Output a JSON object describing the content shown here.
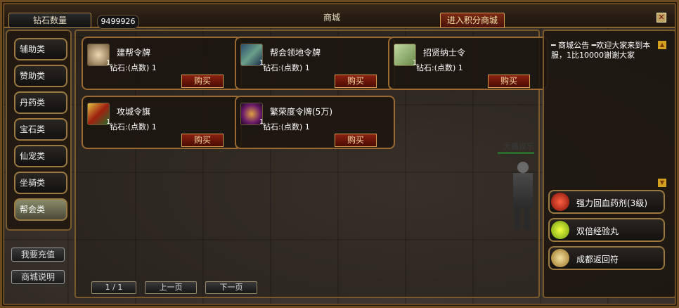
{
  "header": {
    "diamond_label": "钻石数量",
    "diamond_count": "9499926",
    "title": "商城",
    "points_shop_button": "进入积分商城",
    "close_icon": "close-icon"
  },
  "categories": [
    {
      "label": "辅助类"
    },
    {
      "label": "赞助类"
    },
    {
      "label": "丹药类"
    },
    {
      "label": "宝石类"
    },
    {
      "label": "仙宠类"
    },
    {
      "label": "坐骑类"
    },
    {
      "label": "帮会类"
    }
  ],
  "side_buttons": {
    "recharge": "我要充值",
    "help": "商城说明"
  },
  "items": [
    {
      "name": "建帮令牌",
      "qty": "1",
      "price": "钻石:(点数) 1",
      "buy": "购买",
      "icon": "token-icon",
      "color": "#b89a70"
    },
    {
      "name": "帮会领地令牌",
      "qty": "1",
      "price": "钻石:(点数) 1",
      "buy": "购买",
      "icon": "territory-token-icon",
      "color": "#3a6a5a"
    },
    {
      "name": "招贤纳士令",
      "qty": "1",
      "price": "钻石:(点数) 1",
      "buy": "购买",
      "icon": "scroll-icon",
      "color": "#8aa06a"
    },
    {
      "name": "攻城令旗",
      "qty": "1",
      "price": "钻石:(点数) 1",
      "buy": "购买",
      "icon": "flag-icon",
      "color": "#a04020"
    },
    {
      "name": "繁荣度令牌(5万)",
      "qty": "1",
      "price": "钻石:(点数) 1",
      "buy": "购买",
      "icon": "prosperity-token-icon",
      "color": "#6a1a6a"
    }
  ],
  "pagination": {
    "page": "1 / 1",
    "prev": "上一页",
    "next": "下一页"
  },
  "notice": {
    "text": "━ 商城公告 ━欢迎大家来到本服，1比10000谢谢大家"
  },
  "player_name": "大矗娱乐",
  "quick_items": [
    {
      "label": "强力回血药剂(3级)",
      "icon": "red-potion-icon",
      "color": "#c02010"
    },
    {
      "label": "双倍经验丸",
      "icon": "green-pill-icon",
      "color": "#a0c020"
    },
    {
      "label": "成都返回符",
      "icon": "return-scroll-icon",
      "color": "#c0a040"
    }
  ]
}
